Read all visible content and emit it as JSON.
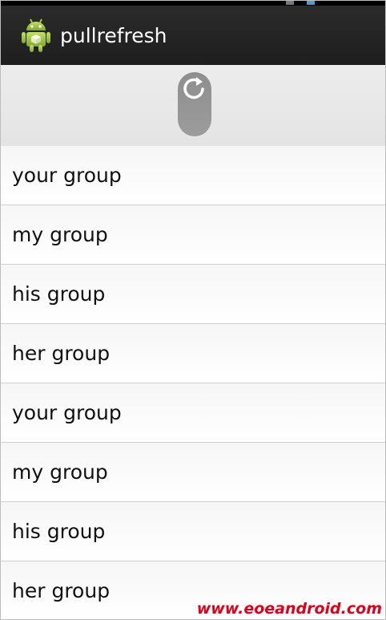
{
  "app": {
    "title": "pullrefresh"
  },
  "refresh_header": {
    "icon": "refresh-icon"
  },
  "list": {
    "items": [
      {
        "label": "your group"
      },
      {
        "label": "my group"
      },
      {
        "label": "his group"
      },
      {
        "label": "her group"
      },
      {
        "label": "your group"
      },
      {
        "label": "my group"
      },
      {
        "label": "his group"
      },
      {
        "label": "her group"
      }
    ]
  },
  "watermark": {
    "text": "www.eoeandroid.com"
  },
  "colors": {
    "action_bar": "#222222",
    "header_bg": "#e8e8e8",
    "watermark": "#e0001a"
  }
}
